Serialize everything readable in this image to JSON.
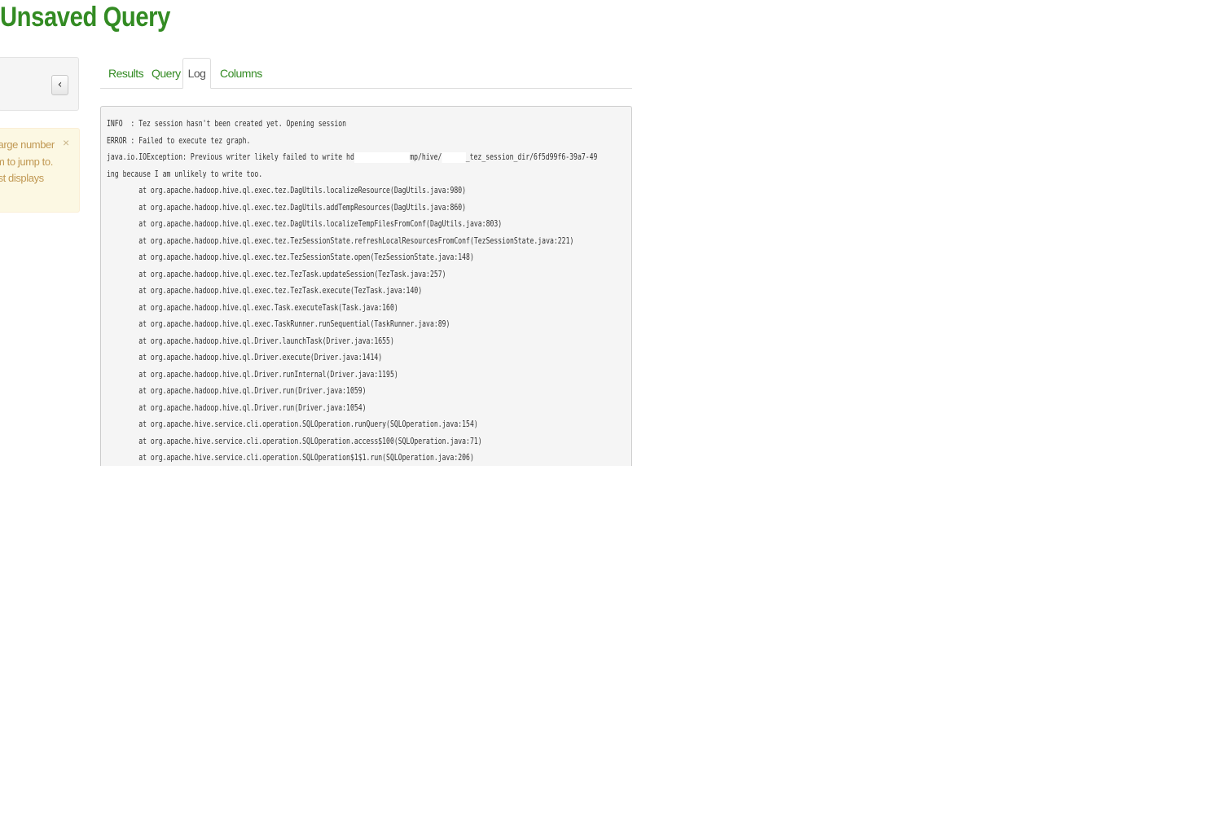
{
  "page": {
    "title": "Unsaved Query"
  },
  "sidebar": {
    "collapse_icon": "chevron-left-icon",
    "collapse_glyph": "‹",
    "alert": {
      "lines": [
        "large number",
        "m to jump to.",
        "ist displays"
      ],
      "close_glyph": "×"
    }
  },
  "tabs": [
    {
      "label": "Results",
      "active": false
    },
    {
      "label": "Query",
      "active": false
    },
    {
      "label": "Log",
      "active": true
    },
    {
      "label": "Columns",
      "active": false
    }
  ],
  "log": {
    "lines": [
      "INFO  : Tez session hasn't been created yet. Opening session",
      "ERROR : Failed to execute tez graph.",
      "java.io.IOException: Previous writer likely failed to write hd▮▮▮▮▮▮▮▮▮▮▮▮▮▮mp/hive/▮▮▮▮▮▮_tez_session_dir/6f5d99f6-39a7-49",
      "ing because I am unlikely to write too.",
      "        at org.apache.hadoop.hive.ql.exec.tez.DagUtils.localizeResource(DagUtils.java:980)",
      "        at org.apache.hadoop.hive.ql.exec.tez.DagUtils.addTempResources(DagUtils.java:860)",
      "        at org.apache.hadoop.hive.ql.exec.tez.DagUtils.localizeTempFilesFromConf(DagUtils.java:803)",
      "        at org.apache.hadoop.hive.ql.exec.tez.TezSessionState.refreshLocalResourcesFromConf(TezSessionState.java:221)",
      "        at org.apache.hadoop.hive.ql.exec.tez.TezSessionState.open(TezSessionState.java:148)",
      "        at org.apache.hadoop.hive.ql.exec.tez.TezTask.updateSession(TezTask.java:257)",
      "        at org.apache.hadoop.hive.ql.exec.tez.TezTask.execute(TezTask.java:140)",
      "        at org.apache.hadoop.hive.ql.exec.Task.executeTask(Task.java:160)",
      "        at org.apache.hadoop.hive.ql.exec.TaskRunner.runSequential(TaskRunner.java:89)",
      "        at org.apache.hadoop.hive.ql.Driver.launchTask(Driver.java:1655)",
      "        at org.apache.hadoop.hive.ql.Driver.execute(Driver.java:1414)",
      "        at org.apache.hadoop.hive.ql.Driver.runInternal(Driver.java:1195)",
      "        at org.apache.hadoop.hive.ql.Driver.run(Driver.java:1059)",
      "        at org.apache.hadoop.hive.ql.Driver.run(Driver.java:1054)",
      "        at org.apache.hive.service.cli.operation.SQLOperation.runQuery(SQLOperation.java:154)",
      "        at org.apache.hive.service.cli.operation.SQLOperation.access$100(SQLOperation.java:71)",
      "        at org.apache.hive.service.cli.operation.SQLOperation$1$1.run(SQLOperation.java:206)"
    ]
  },
  "colors": {
    "accent": "#338b23",
    "log_background": "#f5f5f5",
    "alert_background": "#fcf8e3",
    "alert_text": "#c09853"
  }
}
